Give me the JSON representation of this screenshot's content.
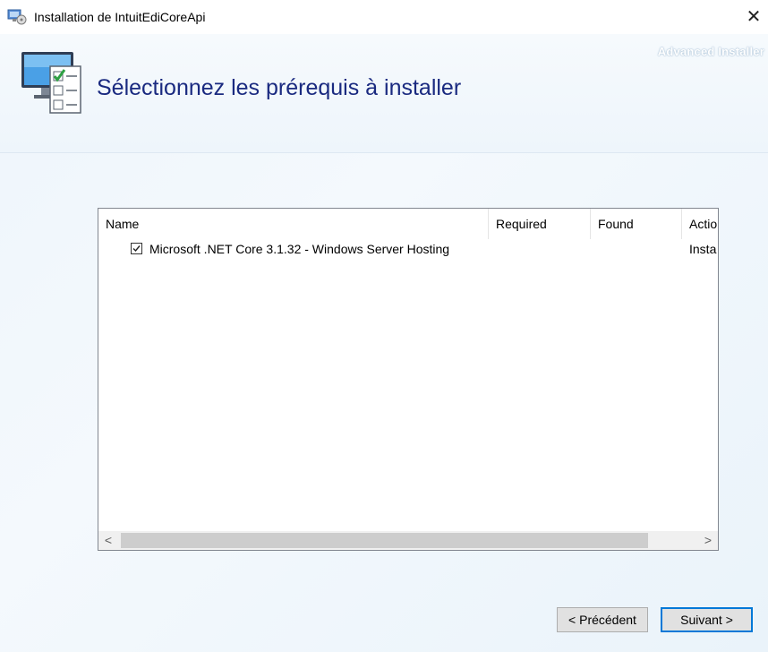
{
  "window": {
    "title": "Installation de IntuitEdiCoreApi",
    "close_symbol": "✕"
  },
  "header": {
    "brand": "Advanced Installer",
    "title": "Sélectionnez les prérequis à installer"
  },
  "list": {
    "columns": [
      "Name",
      "Required",
      "Found",
      "Actio"
    ],
    "rows": [
      {
        "checked": true,
        "name": "Microsoft .NET Core 3.1.32 - Windows Server Hosting",
        "required": "",
        "found": "",
        "action": "Insta"
      }
    ],
    "scroll_left": "<",
    "scroll_right": ">"
  },
  "buttons": {
    "back": "< Précédent",
    "next": "Suivant >"
  },
  "colors": {
    "title": "#1a2a80",
    "default_button_border": "#0078d7"
  },
  "icons": {
    "app": "installer-app-icon",
    "header": "monitor-checklist-icon",
    "close": "close-icon"
  }
}
